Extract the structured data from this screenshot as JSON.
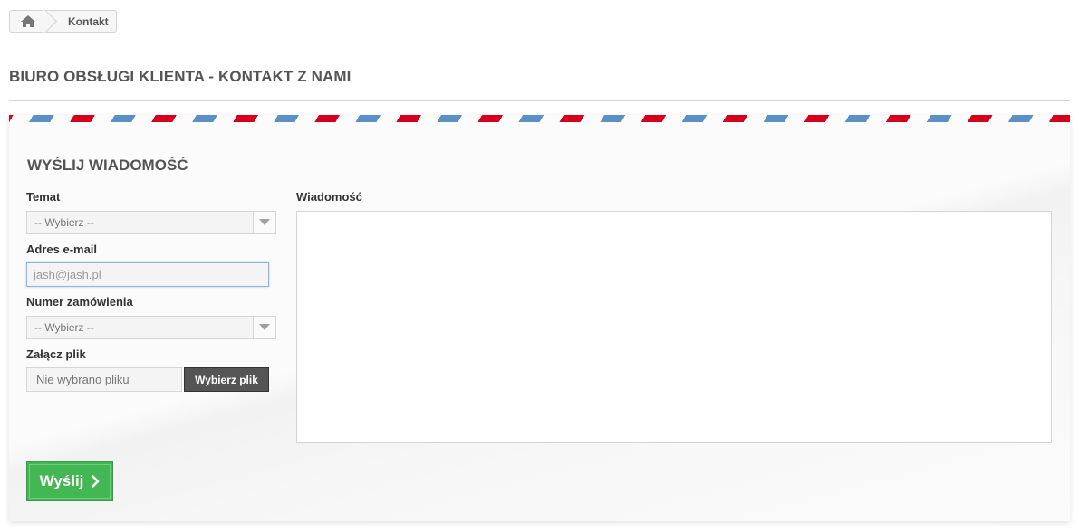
{
  "breadcrumb": {
    "home_icon": "home-icon",
    "current": "Kontakt"
  },
  "page": {
    "heading": "BIURO OBSŁUGI KLIENTA - KONTAKT Z NAMI"
  },
  "form": {
    "title": "WYŚLIJ WIADOMOŚĆ",
    "subject": {
      "label": "Temat",
      "value": "-- Wybierz --"
    },
    "email": {
      "label": "Adres e-mail",
      "value": "jash@jash.pl"
    },
    "order": {
      "label": "Numer zamówienia",
      "value": "-- Wybierz --"
    },
    "attachment": {
      "label": "Załącz plik",
      "filename": "Nie wybrano pliku",
      "button": "Wybierz plik"
    },
    "message": {
      "label": "Wiadomość",
      "value": ""
    },
    "submit": {
      "label": "Wyślij",
      "icon": "chevron-right-icon"
    }
  },
  "colors": {
    "stripe_red": "#d6001c",
    "stripe_blue": "#5a90c6",
    "submit_green": "#43b754",
    "file_button": "#555555"
  }
}
